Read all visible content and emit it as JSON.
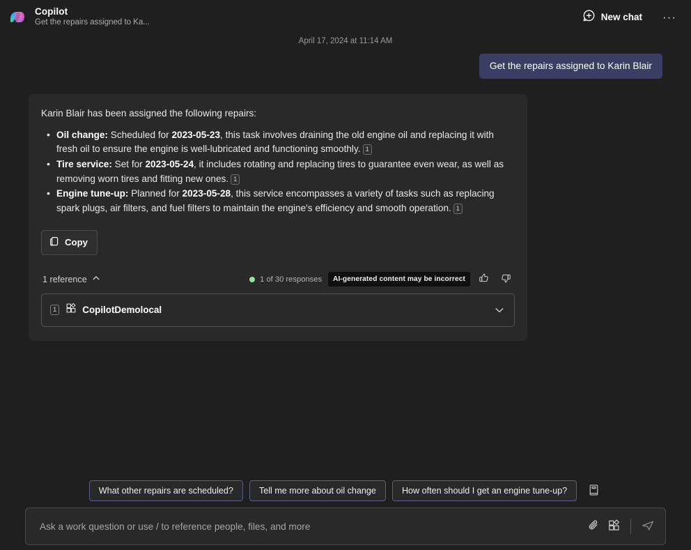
{
  "header": {
    "app_title": "Copilot",
    "subtitle": "Get the repairs assigned to Ka...",
    "logo_icon": "copilot-logo",
    "new_chat_label": "New chat",
    "new_chat_icon": "add-chat-bubble-icon",
    "more_options_label": "···",
    "more_options_icon": "more-horizontal-icon"
  },
  "conversation": {
    "timestamp": "April 17, 2024 at 11:14 AM",
    "user_message": "Get the repairs assigned to Karin Blair",
    "answer": {
      "intro": "Karin Blair has been assigned the following repairs:",
      "bullets": [
        {
          "term": "Oil change:",
          "text_before_date": " Scheduled for ",
          "date": "2023-05-23",
          "text_after_date": ", this task involves draining the old engine oil and replacing it with fresh oil to ensure the engine is well-lubricated and functioning smoothly.",
          "citation": "1"
        },
        {
          "term": "Tire service:",
          "text_before_date": " Set for ",
          "date": "2023-05-24",
          "text_after_date": ", it includes rotating and replacing tires to guarantee even wear, as well as removing worn tires and fitting new ones.",
          "citation": "1"
        },
        {
          "term": "Engine tune-up:",
          "text_before_date": " Planned for ",
          "date": "2023-05-28",
          "text_after_date": ", this service encompasses a variety of tasks such as replacing spark plugs, air filters, and fuel filters to maintain the engine's efficiency and smooth operation.",
          "citation": "1"
        }
      ],
      "copy_label": "Copy",
      "copy_icon": "copy-icon"
    },
    "meta": {
      "references_label": "1 reference",
      "references_chevron_icon": "chevron-up-icon",
      "response_count": "1 of 30 responses",
      "status_dot_color": "#93e49b",
      "ai_disclaimer": "AI-generated content may be incorrect",
      "thumbs_up_icon": "thumbs-up-icon",
      "thumbs_down_icon": "thumbs-down-icon"
    },
    "reference_card": {
      "number": "1",
      "app_icon": "plugin-app-icon",
      "title": "CopilotDemolocal",
      "chevron_icon": "chevron-down-icon"
    }
  },
  "suggestions": {
    "chips": [
      "What other repairs are scheduled?",
      "Tell me more about oil change",
      "How often should I get an engine tune-up?"
    ],
    "prompt_library_icon": "prompt-library-book-icon"
  },
  "composer": {
    "placeholder": "Ask a work question or use / to reference people, files, and more",
    "value": "",
    "attach_icon": "paperclip-icon",
    "apps_icon": "apps-plugin-icon",
    "send_icon": "send-paper-plane-icon"
  },
  "colors": {
    "page_background": "#1f1f1f",
    "card_background": "#292929",
    "user_bubble": "#3b3e63",
    "accent_chip_border": "#5b5e8a",
    "status_green": "#93e49b"
  }
}
